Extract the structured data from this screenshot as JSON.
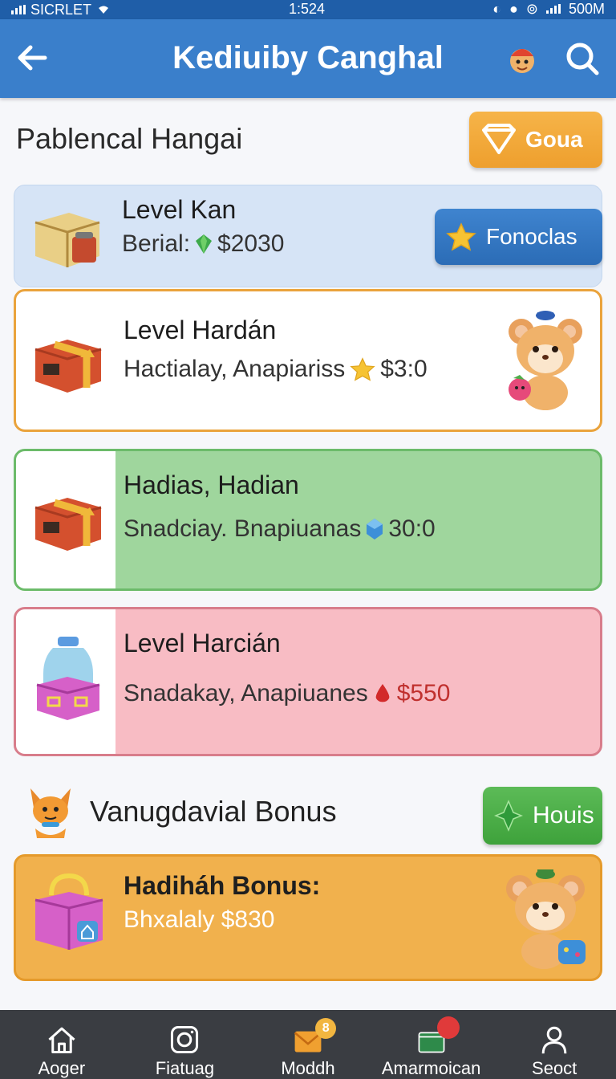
{
  "status": {
    "carrier": "SICRLET",
    "time": "1:524",
    "battery": "500M"
  },
  "appbar": {
    "title": "Kediuiby Canghal"
  },
  "section": {
    "title": "Pablencal Hangai",
    "action_label": "Goua"
  },
  "cards": [
    {
      "name": "Level Kan",
      "sub_prefix": "Berial:",
      "price": "$2030",
      "button_label": "Fonoclas"
    },
    {
      "name": "Level Hardán",
      "sub_prefix": "Hactialay, Anapiariss",
      "price": "$3:0"
    },
    {
      "name": "Hadias, Hadian",
      "sub_prefix": "Snadciay. Bnapiuanas",
      "price": "30:0"
    },
    {
      "name": "Level Harcián",
      "sub_prefix": "Snadakay, Anapiuanes",
      "price": "$550"
    }
  ],
  "bonus": {
    "title": "Vanugdavial Bonus",
    "action_label": "Houis",
    "card_name": "Hadiháh Bonus:",
    "card_sub": "Bhxalaly $830"
  },
  "nav": [
    {
      "label": "Aoger",
      "icon": "home-icon"
    },
    {
      "label": "Fiatuag",
      "icon": "camera-icon"
    },
    {
      "label": "Moddh",
      "icon": "mail-icon",
      "badge": "8"
    },
    {
      "label": "Amarmoican",
      "icon": "map-icon"
    },
    {
      "label": "Seoct",
      "icon": "person-icon"
    }
  ],
  "colors": {
    "header": "#3a7fcb",
    "orange": "#f1b14d",
    "green": "#9fd69d",
    "pink": "#f8bcc4",
    "blue_card": "#d6e4f6"
  }
}
